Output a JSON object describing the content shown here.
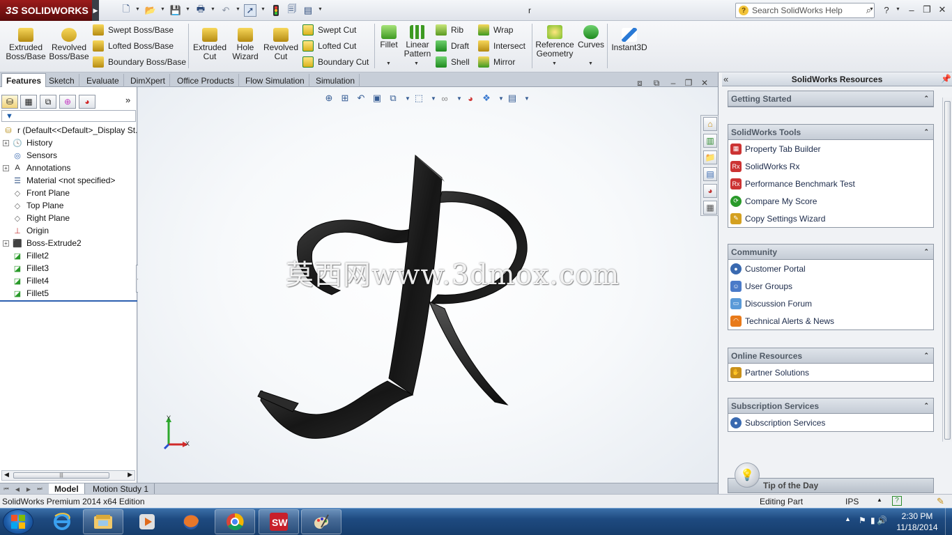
{
  "titlebar": {
    "brand": "SOLIDWORKS",
    "brand_ds": "3S",
    "doc_title": "r",
    "help_search_placeholder": "Search SolidWorks Help"
  },
  "command_manager": {
    "extruded_boss": [
      "Extruded",
      "Boss/Base"
    ],
    "revolved_boss": [
      "Revolved",
      "Boss/Base"
    ],
    "swept_boss": "Swept Boss/Base",
    "lofted_boss": "Lofted Boss/Base",
    "boundary_boss": "Boundary Boss/Base",
    "extruded_cut": [
      "Extruded",
      "Cut"
    ],
    "hole_wizard": [
      "Hole",
      "Wizard"
    ],
    "revolved_cut": [
      "Revolved",
      "Cut"
    ],
    "swept_cut": "Swept Cut",
    "lofted_cut": "Lofted Cut",
    "boundary_cut": "Boundary Cut",
    "fillet": "Fillet",
    "linear_pattern": [
      "Linear",
      "Pattern"
    ],
    "rib": "Rib",
    "draft": "Draft",
    "shell": "Shell",
    "wrap": "Wrap",
    "intersect": "Intersect",
    "mirror": "Mirror",
    "reference_geometry": [
      "Reference",
      "Geometry"
    ],
    "curves": "Curves",
    "instant3d": "Instant3D"
  },
  "tabs": [
    "Features",
    "Sketch",
    "Evaluate",
    "DimXpert",
    "Office Products",
    "Flow Simulation",
    "Simulation"
  ],
  "feature_tree": {
    "root": "r  (Default<<Default>_Display St...",
    "items": [
      {
        "label": "History",
        "icon": "history-icon",
        "expandable": true
      },
      {
        "label": "Sensors",
        "icon": "sensors-icon",
        "expandable": false
      },
      {
        "label": "Annotations",
        "icon": "annotations-icon",
        "expandable": true
      },
      {
        "label": "Material <not specified>",
        "icon": "material-icon",
        "expandable": false
      },
      {
        "label": "Front Plane",
        "icon": "plane-icon",
        "expandable": false
      },
      {
        "label": "Top Plane",
        "icon": "plane-icon",
        "expandable": false
      },
      {
        "label": "Right Plane",
        "icon": "plane-icon",
        "expandable": false
      },
      {
        "label": "Origin",
        "icon": "origin-icon",
        "expandable": false
      },
      {
        "label": "Boss-Extrude2",
        "icon": "extrude-icon",
        "expandable": true
      },
      {
        "label": "Fillet2",
        "icon": "fillet-icon",
        "expandable": false
      },
      {
        "label": "Fillet3",
        "icon": "fillet-icon",
        "expandable": false
      },
      {
        "label": "Fillet4",
        "icon": "fillet-icon",
        "expandable": false
      },
      {
        "label": "Fillet5",
        "icon": "fillet-icon",
        "expandable": false
      }
    ]
  },
  "viewport": {
    "watermark": "莫西网www.3dmox.com",
    "triad_x": "X",
    "triad_y": "Y"
  },
  "bottom_tabs": [
    "Model",
    "Motion Study 1"
  ],
  "resources": {
    "title": "SolidWorks Resources",
    "sections": [
      {
        "title": "Getting Started",
        "items": []
      },
      {
        "title": "SolidWorks Tools",
        "items": [
          "Property Tab Builder",
          "SolidWorks Rx",
          "Performance Benchmark Test",
          "Compare My Score",
          "Copy Settings Wizard"
        ]
      },
      {
        "title": "Community",
        "items": [
          "Customer Portal",
          "User Groups",
          "Discussion Forum",
          "Technical Alerts & News"
        ]
      },
      {
        "title": "Online Resources",
        "items": [
          "Partner Solutions"
        ]
      },
      {
        "title": "Subscription Services",
        "items": [
          "Subscription Services"
        ]
      }
    ],
    "tip": "Tip of the Day"
  },
  "statusbar": {
    "edition": "SolidWorks Premium 2014 x64 Edition",
    "mode": "Editing Part",
    "units": "IPS"
  },
  "taskbar": {
    "time": "2:30 PM",
    "date": "11/18/2014"
  },
  "colors": {
    "brand_red": "#9b1b1b",
    "model_black": "#1c1c1c",
    "taskbar_blue": "#1e4a80"
  }
}
